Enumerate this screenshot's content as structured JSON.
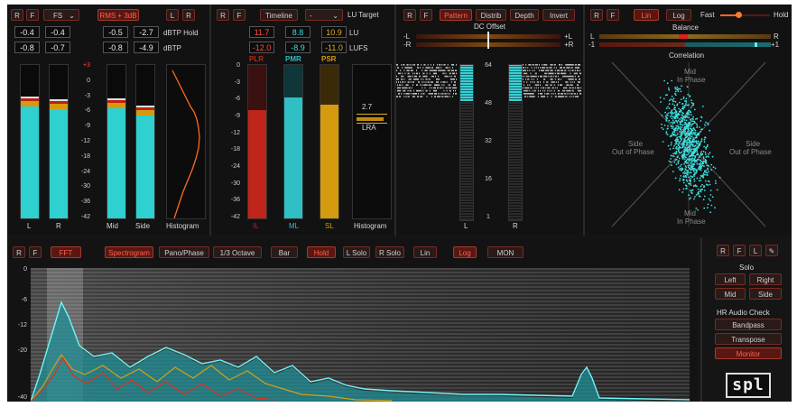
{
  "colors": {
    "accent_red": "#c0392b",
    "cyan": "#2fd0d0",
    "amber": "#d4a017",
    "orange": "#ff6a20"
  },
  "level": {
    "buttons": [
      "R",
      "F",
      "FS",
      "RMS + 3dB",
      "L",
      "R"
    ],
    "peak_row1": [
      "-0.4",
      "-0.4"
    ],
    "peak_row2": [
      "-0.8",
      "-0.7"
    ],
    "ms_row1": [
      "-0.5",
      "-2.7"
    ],
    "ms_row2": [
      "-0.8",
      "-4.9"
    ],
    "row1_label": "dBTP Hold",
    "row2_label": "dBTP",
    "scale": [
      "+3",
      "0",
      "-3",
      "-6",
      "-9",
      "-12",
      "-18",
      "-24",
      "-30",
      "-36",
      "-42"
    ],
    "meters": [
      {
        "label": "L",
        "level": 0.78
      },
      {
        "label": "R",
        "level": 0.76
      },
      {
        "label": "Mid",
        "level": 0.77
      },
      {
        "label": "Side",
        "level": 0.72
      }
    ],
    "histogram_label": "Histogram"
  },
  "loudness": {
    "buttons": [
      "R",
      "F",
      "Timeline",
      "-",
      "LU Target"
    ],
    "row1": [
      "11.7",
      "8.8",
      "10.9"
    ],
    "row1_unit": "LU",
    "row2": [
      "-12.0",
      "-8.9",
      "-11.0"
    ],
    "row2_unit": "LUFS",
    "scale": [
      "0",
      "-3",
      "-6",
      "-9",
      "-12",
      "-18",
      "-24",
      "-30",
      "-36",
      "-42"
    ],
    "bars": [
      {
        "top": "PLR",
        "bottom": "IL",
        "level": 0.7,
        "color": "#c0251a"
      },
      {
        "top": "PMR",
        "bottom": "ML",
        "level": 0.78,
        "color": "#2fbfc4"
      },
      {
        "top": "PSR",
        "bottom": "SL",
        "level": 0.73,
        "color": "#d49a10"
      }
    ],
    "lra_value": "2.7",
    "lra_label": "LRA",
    "histogram_label": "Histogram"
  },
  "correlation_panel": {
    "buttons": [
      "R",
      "F",
      "Pattern",
      "Distrib",
      "Depth",
      "Invert"
    ],
    "dc_offset": "DC Offset",
    "scale": [
      "64",
      "48",
      "32",
      "16",
      "1"
    ],
    "left_label": "L",
    "right_label": "R",
    "bar_left_top": "-L",
    "bar_left_bottom": "-R",
    "bar_right_top": "+L",
    "bar_right_bottom": "+R"
  },
  "goniometer": {
    "buttons": [
      "R",
      "F",
      "Lin",
      "Log"
    ],
    "speed_fast": "Fast",
    "speed_hold": "Hold",
    "balance": "Balance",
    "correlation": "Correlation",
    "bal_l": "L",
    "bal_r": "R",
    "cor_l": "-1",
    "cor_r": "+1",
    "mid_top": [
      "Mid",
      "In Phase"
    ],
    "side_left": [
      "Side",
      "Out of Phase"
    ],
    "side_right": [
      "Side",
      "Out of Phase"
    ],
    "mid_bottom": [
      "Mid",
      "In Phase"
    ]
  },
  "spectrum": {
    "buttons": [
      "R",
      "F",
      "FFT",
      "Spectrogram",
      "Pano/Phase",
      "1/3 Octave",
      "Bar",
      "Hold",
      "L Solo",
      "R Solo",
      "Lin",
      "Log",
      "MON"
    ],
    "scale": [
      "0",
      "-6",
      "-12",
      "-20",
      "-40"
    ]
  },
  "side_controls": {
    "buttons": [
      "R",
      "F",
      "L"
    ],
    "solo_title": "Solo",
    "solo": [
      "Left",
      "Right",
      "Mid",
      "Side"
    ],
    "hr_title": "HR Audio Check",
    "hr": [
      "Bandpass",
      "Transpose",
      "Monitor"
    ],
    "logo": "spl"
  }
}
